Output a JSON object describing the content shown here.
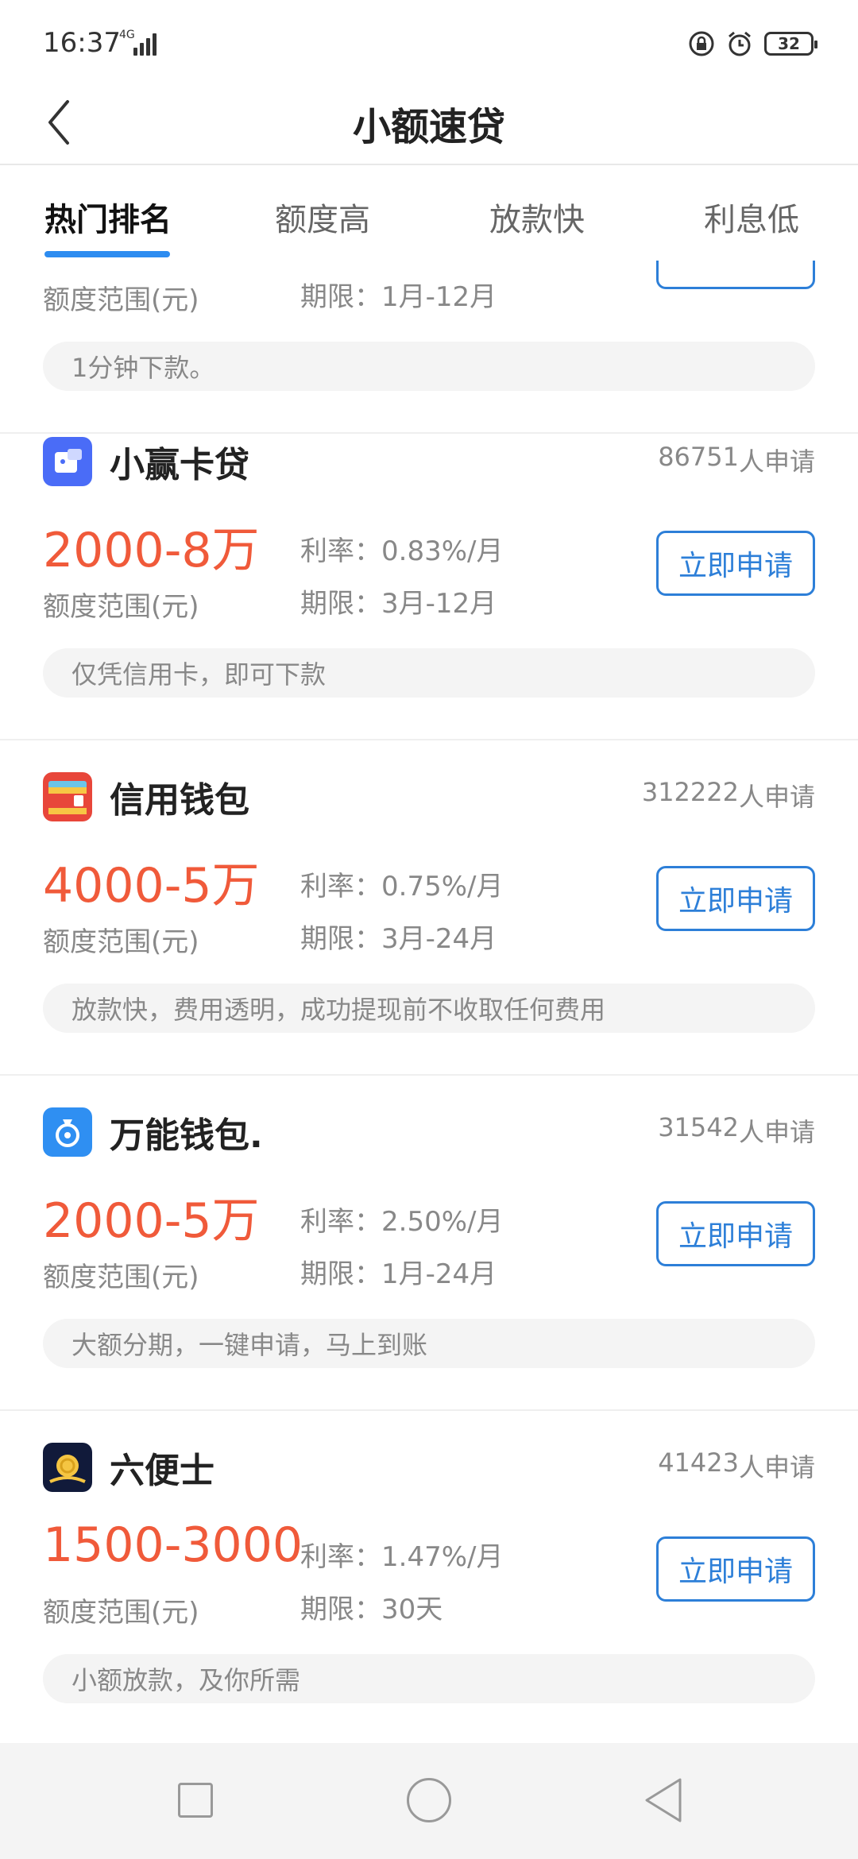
{
  "status_bar": {
    "time": "16:37",
    "network": "4G",
    "battery": "32",
    "icons": [
      "lock-icon",
      "alarm-icon",
      "battery-icon",
      "signal-icon"
    ]
  },
  "header": {
    "title": "小额速贷",
    "back_icon": "chevron-left-icon"
  },
  "tabs": [
    {
      "label": "热门排名",
      "active": true
    },
    {
      "label": "额度高",
      "active": false
    },
    {
      "label": "放款快",
      "active": false
    },
    {
      "label": "利息低",
      "active": false
    }
  ],
  "colors": {
    "accent": "#2d8cf0",
    "amount": "#f05a3a",
    "button": "#2d7fd8"
  },
  "partial_card": {
    "amount_label": "额度范围(元)",
    "term_label": "期限：",
    "term": "1月-12月",
    "tag": "1分钟下款。"
  },
  "cards": [
    {
      "name": "小赢卡贷",
      "logo_icon": "card-wallet-icon",
      "applicants": "86751",
      "applicants_suffix": "人申请",
      "amount": "2000-8万",
      "amount_label": "额度范围(元)",
      "rate_label": "利率：",
      "rate": "0.83%/月",
      "term_label": "期限：",
      "term": "3月-12月",
      "apply_label": "立即申请",
      "tag": "仅凭信用卡，即可下款"
    },
    {
      "name": "信用钱包",
      "logo_icon": "credit-wallet-icon",
      "applicants": "312222",
      "applicants_suffix": "人申请",
      "amount": "4000-5万",
      "amount_label": "额度范围(元)",
      "rate_label": "利率：",
      "rate": "0.75%/月",
      "term_label": "期限：",
      "term": "3月-24月",
      "apply_label": "立即申请",
      "tag": "放款快，费用透明，成功提现前不收取任何费用"
    },
    {
      "name": "万能钱包.",
      "logo_icon": "money-bag-icon",
      "applicants": "31542",
      "applicants_suffix": "人申请",
      "amount": "2000-5万",
      "amount_label": "额度范围(元)",
      "rate_label": "利率：",
      "rate": "2.50%/月",
      "term_label": "期限：",
      "term": "1月-24月",
      "apply_label": "立即申请",
      "tag": "大额分期，一键申请，马上到账"
    },
    {
      "name": "六便士",
      "logo_icon": "coin-icon",
      "applicants": "41423",
      "applicants_suffix": "人申请",
      "amount": "1500-3000",
      "amount_label": "额度范围(元)",
      "rate_label": "利率：",
      "rate": "1.47%/月",
      "term_label": "期限：",
      "term": "30天",
      "apply_label": "立即申请",
      "tag": "小额放款，及你所需"
    }
  ],
  "system_nav": [
    "recent-apps-icon",
    "home-icon",
    "back-icon"
  ]
}
